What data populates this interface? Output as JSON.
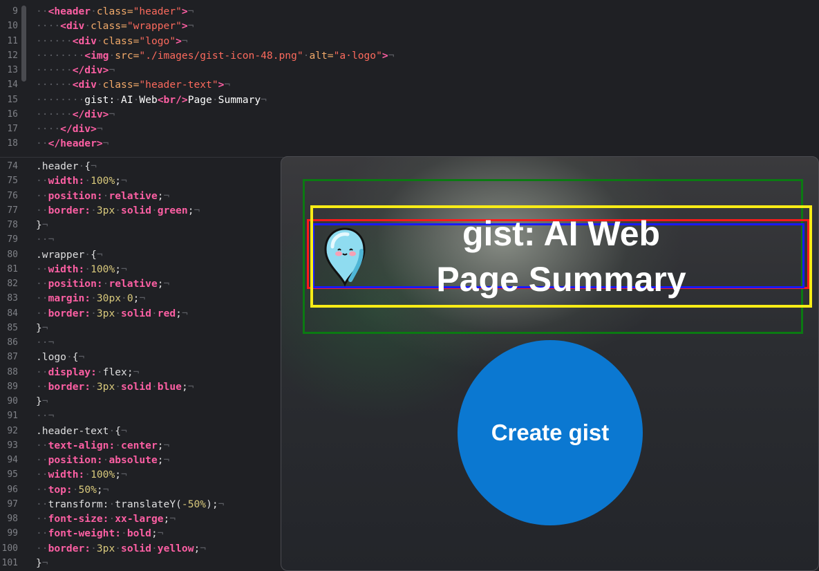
{
  "editor": {
    "html_lines": [
      {
        "n": "9",
        "tokens": [
          [
            "inv",
            "··"
          ],
          [
            "tag",
            "<header"
          ],
          [
            "inv",
            "·"
          ],
          [
            "attr",
            "class="
          ],
          [
            "str",
            "\"header\""
          ],
          [
            "tag",
            ">"
          ],
          [
            "inv",
            "¬"
          ]
        ]
      },
      {
        "n": "10",
        "tokens": [
          [
            "inv",
            "····"
          ],
          [
            "tag",
            "<div"
          ],
          [
            "inv",
            "·"
          ],
          [
            "attr",
            "class="
          ],
          [
            "str",
            "\"wrapper\""
          ],
          [
            "tag",
            ">"
          ],
          [
            "inv",
            "¬"
          ]
        ]
      },
      {
        "n": "11",
        "tokens": [
          [
            "inv",
            "······"
          ],
          [
            "tag",
            "<div"
          ],
          [
            "inv",
            "·"
          ],
          [
            "attr",
            "class="
          ],
          [
            "str",
            "\"logo\""
          ],
          [
            "tag",
            ">"
          ],
          [
            "inv",
            "¬"
          ]
        ]
      },
      {
        "n": "12",
        "tokens": [
          [
            "inv",
            "········"
          ],
          [
            "tag",
            "<img"
          ],
          [
            "inv",
            "·"
          ],
          [
            "attr",
            "src="
          ],
          [
            "str",
            "\"./images/gist-icon-48.png\""
          ],
          [
            "inv",
            "·"
          ],
          [
            "attr",
            "alt="
          ],
          [
            "str",
            "\"a·logo\""
          ],
          [
            "tag",
            ">"
          ],
          [
            "inv",
            "¬"
          ]
        ]
      },
      {
        "n": "13",
        "tokens": [
          [
            "inv",
            "······"
          ],
          [
            "tag",
            "</div>"
          ],
          [
            "inv",
            "¬"
          ]
        ]
      },
      {
        "n": "14",
        "tokens": [
          [
            "inv",
            "······"
          ],
          [
            "tag",
            "<div"
          ],
          [
            "inv",
            "·"
          ],
          [
            "attr",
            "class="
          ],
          [
            "str",
            "\"header-text\""
          ],
          [
            "tag",
            ">"
          ],
          [
            "inv",
            "¬"
          ]
        ]
      },
      {
        "n": "15",
        "tokens": [
          [
            "inv",
            "········"
          ],
          [
            "txt",
            "gist:"
          ],
          [
            "inv",
            "·"
          ],
          [
            "txt",
            "AI"
          ],
          [
            "inv",
            "·"
          ],
          [
            "txt",
            "Web"
          ],
          [
            "tag",
            "<br/>"
          ],
          [
            "txt",
            "Page"
          ],
          [
            "inv",
            "·"
          ],
          [
            "txt",
            "Summary"
          ],
          [
            "inv",
            "¬"
          ]
        ]
      },
      {
        "n": "16",
        "tokens": [
          [
            "inv",
            "······"
          ],
          [
            "tag",
            "</div>"
          ],
          [
            "inv",
            "¬"
          ]
        ]
      },
      {
        "n": "17",
        "tokens": [
          [
            "inv",
            "····"
          ],
          [
            "tag",
            "</div>"
          ],
          [
            "inv",
            "¬"
          ]
        ]
      },
      {
        "n": "18",
        "tokens": [
          [
            "inv",
            "··"
          ],
          [
            "tag",
            "</header>"
          ],
          [
            "inv",
            "¬"
          ]
        ]
      }
    ],
    "css_lines": [
      {
        "n": "74",
        "tokens": [
          [
            "sel",
            ".header"
          ],
          [
            "inv",
            "·"
          ],
          [
            "sel",
            "{"
          ],
          [
            "inv",
            "¬"
          ]
        ]
      },
      {
        "n": "75",
        "tokens": [
          [
            "inv",
            "··"
          ],
          [
            "prop",
            "width:"
          ],
          [
            "inv",
            "·"
          ],
          [
            "num",
            "100%"
          ],
          [
            "val",
            ";"
          ],
          [
            "inv",
            "¬"
          ]
        ]
      },
      {
        "n": "76",
        "tokens": [
          [
            "inv",
            "··"
          ],
          [
            "prop",
            "position:"
          ],
          [
            "inv",
            "·"
          ],
          [
            "prop",
            "relative"
          ],
          [
            "val",
            ";"
          ],
          [
            "inv",
            "¬"
          ]
        ]
      },
      {
        "n": "77",
        "tokens": [
          [
            "inv",
            "··"
          ],
          [
            "prop",
            "border:"
          ],
          [
            "inv",
            "·"
          ],
          [
            "num",
            "3px"
          ],
          [
            "inv",
            "·"
          ],
          [
            "prop",
            "solid"
          ],
          [
            "inv",
            "·"
          ],
          [
            "prop",
            "green"
          ],
          [
            "val",
            ";"
          ],
          [
            "inv",
            "¬"
          ]
        ]
      },
      {
        "n": "78",
        "tokens": [
          [
            "sel",
            "}"
          ],
          [
            "inv",
            "¬"
          ]
        ]
      },
      {
        "n": "79",
        "tokens": [
          [
            "inv",
            "··¬"
          ]
        ]
      },
      {
        "n": "80",
        "tokens": [
          [
            "sel",
            ".wrapper"
          ],
          [
            "inv",
            "·"
          ],
          [
            "sel",
            "{"
          ],
          [
            "inv",
            "¬"
          ]
        ]
      },
      {
        "n": "81",
        "tokens": [
          [
            "inv",
            "··"
          ],
          [
            "prop",
            "width:"
          ],
          [
            "inv",
            "·"
          ],
          [
            "num",
            "100%"
          ],
          [
            "val",
            ";"
          ],
          [
            "inv",
            "¬"
          ]
        ]
      },
      {
        "n": "82",
        "tokens": [
          [
            "inv",
            "··"
          ],
          [
            "prop",
            "position:"
          ],
          [
            "inv",
            "·"
          ],
          [
            "prop",
            "relative"
          ],
          [
            "val",
            ";"
          ],
          [
            "inv",
            "¬"
          ]
        ]
      },
      {
        "n": "83",
        "tokens": [
          [
            "inv",
            "··"
          ],
          [
            "prop",
            "margin:"
          ],
          [
            "inv",
            "·"
          ],
          [
            "num",
            "30px"
          ],
          [
            "inv",
            "·"
          ],
          [
            "num",
            "0"
          ],
          [
            "val",
            ";"
          ],
          [
            "inv",
            "¬"
          ]
        ]
      },
      {
        "n": "84",
        "tokens": [
          [
            "inv",
            "··"
          ],
          [
            "prop",
            "border:"
          ],
          [
            "inv",
            "·"
          ],
          [
            "num",
            "3px"
          ],
          [
            "inv",
            "·"
          ],
          [
            "prop",
            "solid"
          ],
          [
            "inv",
            "·"
          ],
          [
            "prop",
            "red"
          ],
          [
            "val",
            ";"
          ],
          [
            "inv",
            "¬"
          ]
        ]
      },
      {
        "n": "85",
        "tokens": [
          [
            "sel",
            "}"
          ],
          [
            "inv",
            "¬"
          ]
        ]
      },
      {
        "n": "86",
        "tokens": [
          [
            "inv",
            "··¬"
          ]
        ]
      },
      {
        "n": "87",
        "tokens": [
          [
            "sel",
            ".logo"
          ],
          [
            "inv",
            "·"
          ],
          [
            "sel",
            "{"
          ],
          [
            "inv",
            "¬"
          ]
        ]
      },
      {
        "n": "88",
        "tokens": [
          [
            "inv",
            "··"
          ],
          [
            "prop",
            "display:"
          ],
          [
            "inv",
            "·"
          ],
          [
            "val",
            "flex;"
          ],
          [
            "inv",
            "¬"
          ]
        ]
      },
      {
        "n": "89",
        "tokens": [
          [
            "inv",
            "··"
          ],
          [
            "prop",
            "border:"
          ],
          [
            "inv",
            "·"
          ],
          [
            "num",
            "3px"
          ],
          [
            "inv",
            "·"
          ],
          [
            "prop",
            "solid"
          ],
          [
            "inv",
            "·"
          ],
          [
            "prop",
            "blue"
          ],
          [
            "val",
            ";"
          ],
          [
            "inv",
            "¬"
          ]
        ]
      },
      {
        "n": "90",
        "tokens": [
          [
            "sel",
            "}"
          ],
          [
            "inv",
            "¬"
          ]
        ]
      },
      {
        "n": "91",
        "tokens": [
          [
            "inv",
            "··¬"
          ]
        ]
      },
      {
        "n": "92",
        "tokens": [
          [
            "sel",
            ".header-text"
          ],
          [
            "inv",
            "·"
          ],
          [
            "sel",
            "{"
          ],
          [
            "inv",
            "¬"
          ]
        ]
      },
      {
        "n": "93",
        "tokens": [
          [
            "inv",
            "··"
          ],
          [
            "prop",
            "text-align:"
          ],
          [
            "inv",
            "·"
          ],
          [
            "prop",
            "center"
          ],
          [
            "val",
            ";"
          ],
          [
            "inv",
            "¬"
          ]
        ]
      },
      {
        "n": "94",
        "tokens": [
          [
            "inv",
            "··"
          ],
          [
            "prop",
            "position:"
          ],
          [
            "inv",
            "·"
          ],
          [
            "prop",
            "absolute"
          ],
          [
            "val",
            ";"
          ],
          [
            "inv",
            "¬"
          ]
        ]
      },
      {
        "n": "95",
        "tokens": [
          [
            "inv",
            "··"
          ],
          [
            "prop",
            "width:"
          ],
          [
            "inv",
            "·"
          ],
          [
            "num",
            "100%"
          ],
          [
            "val",
            ";"
          ],
          [
            "inv",
            "¬"
          ]
        ]
      },
      {
        "n": "96",
        "tokens": [
          [
            "inv",
            "··"
          ],
          [
            "prop",
            "top:"
          ],
          [
            "inv",
            "·"
          ],
          [
            "num",
            "50%"
          ],
          [
            "val",
            ";"
          ],
          [
            "inv",
            "¬"
          ]
        ]
      },
      {
        "n": "97",
        "tokens": [
          [
            "inv",
            "··"
          ],
          [
            "val",
            "transform:"
          ],
          [
            "inv",
            "·"
          ],
          [
            "val",
            "translateY("
          ],
          [
            "num",
            "-50%"
          ],
          [
            "val",
            ");"
          ],
          [
            "inv",
            "¬"
          ]
        ]
      },
      {
        "n": "98",
        "tokens": [
          [
            "inv",
            "··"
          ],
          [
            "prop",
            "font-size:"
          ],
          [
            "inv",
            "·"
          ],
          [
            "prop",
            "xx-large"
          ],
          [
            "val",
            ";"
          ],
          [
            "inv",
            "¬"
          ]
        ]
      },
      {
        "n": "99",
        "tokens": [
          [
            "inv",
            "··"
          ],
          [
            "prop",
            "font-weight:"
          ],
          [
            "inv",
            "·"
          ],
          [
            "prop",
            "bold"
          ],
          [
            "val",
            ";"
          ],
          [
            "inv",
            "¬"
          ]
        ]
      },
      {
        "n": "100",
        "tokens": [
          [
            "inv",
            "··"
          ],
          [
            "prop",
            "border:"
          ],
          [
            "inv",
            "·"
          ],
          [
            "num",
            "3px"
          ],
          [
            "inv",
            "·"
          ],
          [
            "prop",
            "solid"
          ],
          [
            "inv",
            "·"
          ],
          [
            "prop",
            "yellow"
          ],
          [
            "val",
            ";"
          ],
          [
            "inv",
            "¬"
          ]
        ]
      },
      {
        "n": "101",
        "tokens": [
          [
            "sel",
            "}"
          ],
          [
            "inv",
            "¬"
          ]
        ]
      }
    ]
  },
  "preview": {
    "logo_alt": "a logo",
    "header_line1": "gist: AI Web",
    "header_line2": "Page Summary",
    "button_label": "Create gist",
    "colors": {
      "header_border": "#0b7a12",
      "wrapper_border": "#ff1a1a",
      "logo_border": "#1a1aff",
      "header_text_border": "#f8ec16",
      "button": "#0b78d1"
    }
  }
}
